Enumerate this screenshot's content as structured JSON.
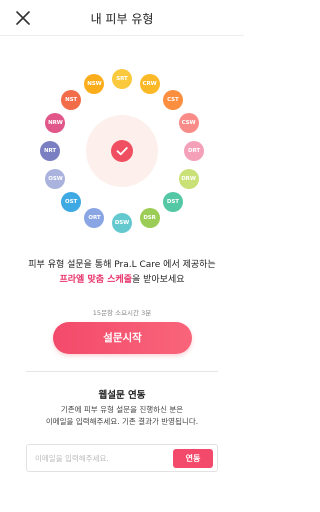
{
  "header": {
    "title": "내 피부 유형",
    "close_icon": "close-icon"
  },
  "wheel": {
    "center_icon": "check-icon",
    "center_color": "#ef4f60",
    "types": [
      {
        "code": "SRT",
        "color": "#fbc93e"
      },
      {
        "code": "CRW",
        "color": "#fbb928"
      },
      {
        "code": "CST",
        "color": "#fb8f3f"
      },
      {
        "code": "CSW",
        "color": "#f98c89"
      },
      {
        "code": "DRT",
        "color": "#f3a0b8"
      },
      {
        "code": "DRW",
        "color": "#c9e176"
      },
      {
        "code": "DST",
        "color": "#54c8a4"
      },
      {
        "code": "DSR",
        "color": "#9bcc55"
      },
      {
        "code": "DSW",
        "color": "#64c9cf"
      },
      {
        "code": "ORT",
        "color": "#8aa5e3"
      },
      {
        "code": "OST",
        "color": "#3fa9e4"
      },
      {
        "code": "OSW",
        "color": "#a9b3de"
      },
      {
        "code": "NRT",
        "color": "#7a7fc1"
      },
      {
        "code": "NRW",
        "color": "#e1578a"
      },
      {
        "code": "NST",
        "color": "#f36c4a"
      },
      {
        "code": "NSW",
        "color": "#fbad1c"
      }
    ]
  },
  "intro": {
    "line1": "피부 유형 설문을 통해 Pra.L Care 에서 제공하는",
    "line2_highlight": "프라엘 맞춤 스케줄",
    "line2_rest": "을 받아보세요"
  },
  "survey": {
    "time_info": "15문항 소요시간 3분",
    "start_label": "설문시작"
  },
  "web_survey": {
    "title": "웹설문 연동",
    "desc1": "기존에 피부 유형 설문을 진행하신 분은",
    "desc2": "이메일을 입력해주세요. 기존 결과가 반영됩니다.",
    "email_value": "",
    "email_placeholder": "이메일을 입력해주세요.",
    "link_label": "연동"
  },
  "colors": {
    "accent": "#f34a6b",
    "highlight": "#e8316a"
  }
}
